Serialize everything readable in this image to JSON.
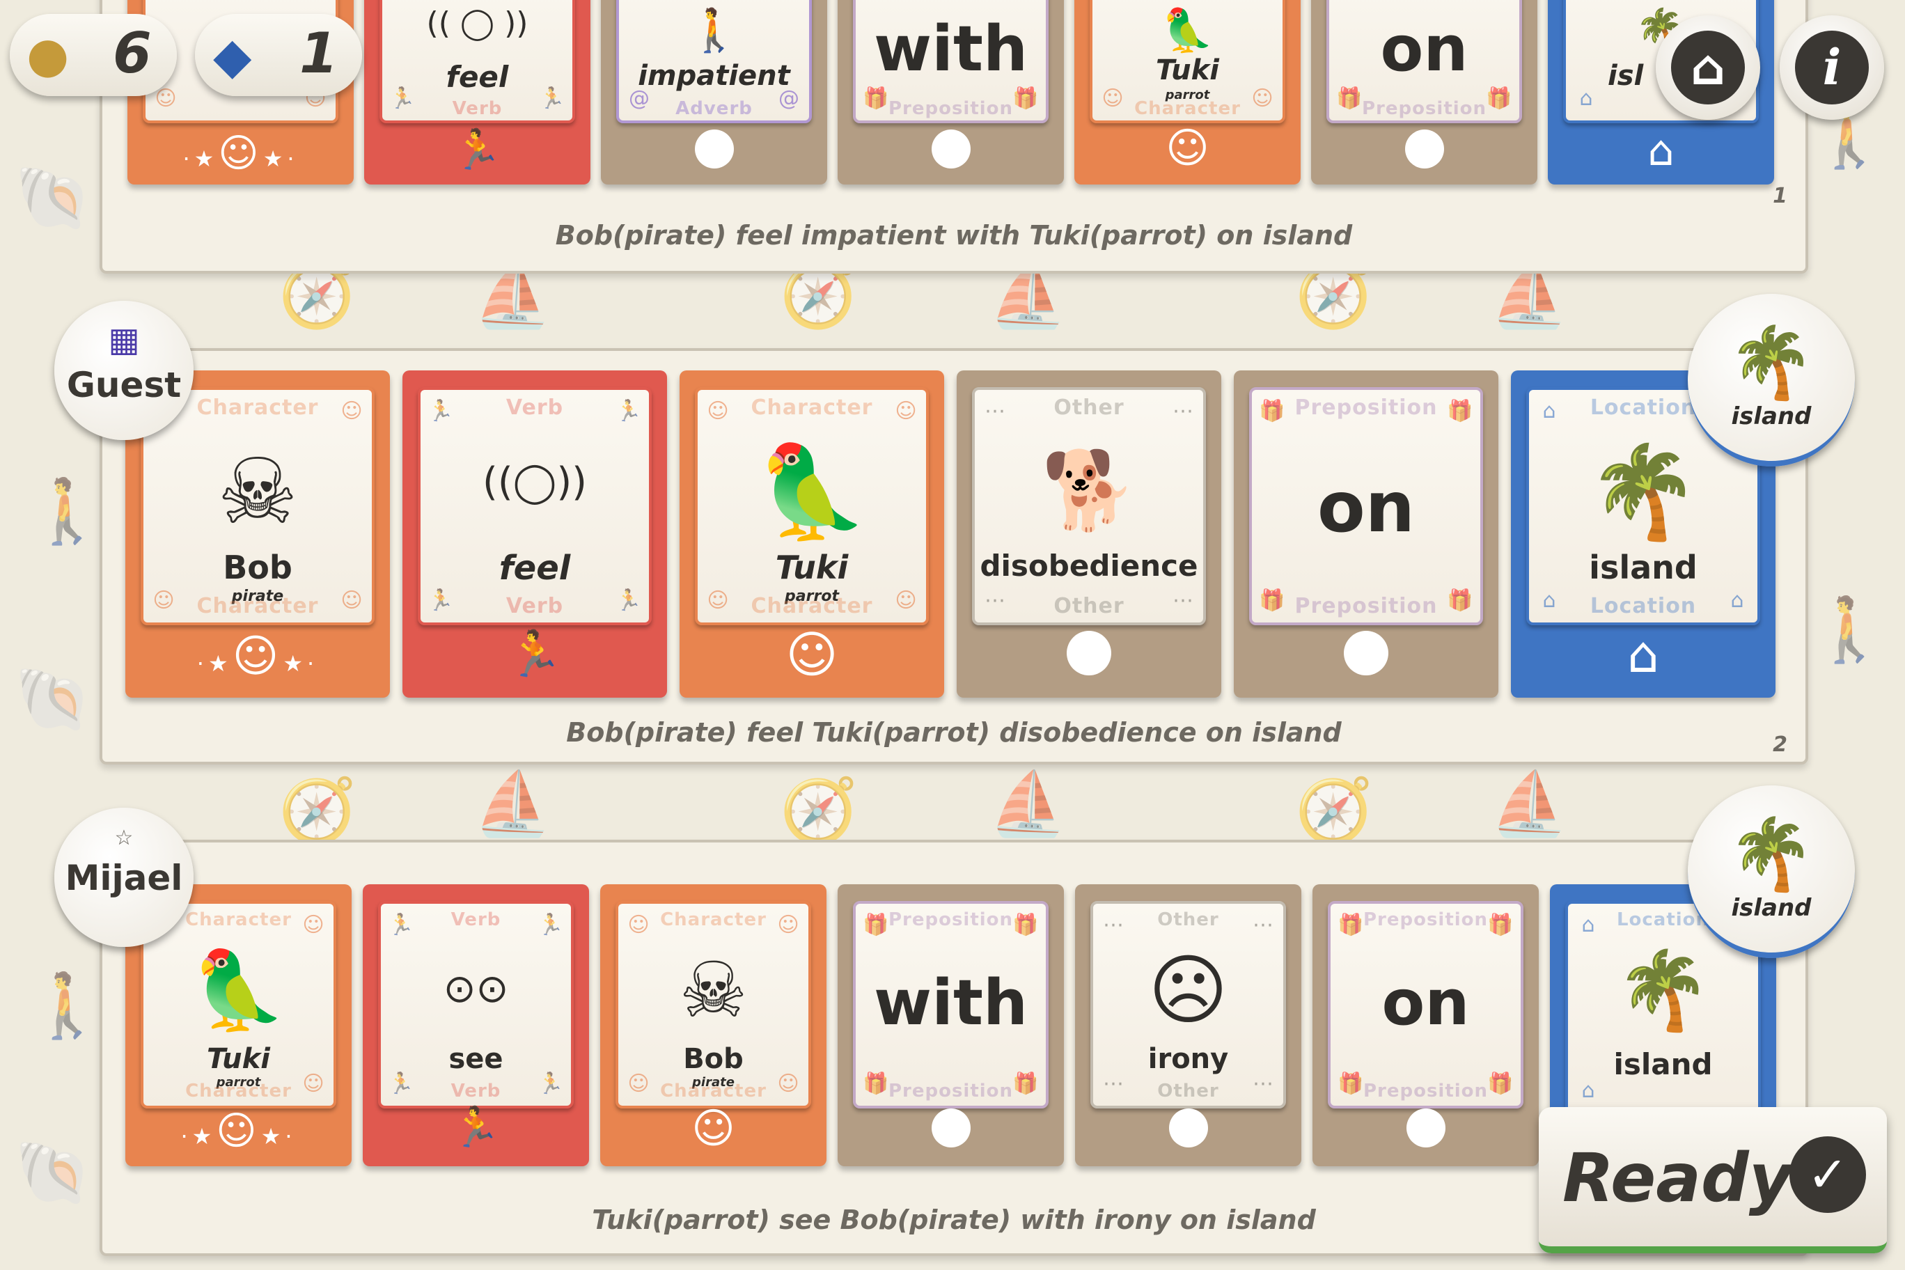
{
  "hud": {
    "coins": "6",
    "gems": "1"
  },
  "colors": {
    "character": "#e8844f",
    "verb": "#e0594f",
    "neutral": "#b39d84",
    "location": "#3f75c3",
    "ready_bar": "#54a347"
  },
  "rows": [
    {
      "caption": "Bob(pirate) feel impatient with Tuki(parrot) on island",
      "number": "1",
      "cards": [
        {
          "type": "character",
          "word": "",
          "sub": "",
          "cat": "Character",
          "icon": "",
          "footer": "stars-smile"
        },
        {
          "type": "verb",
          "word": "feel",
          "cat": "Verb",
          "icon": "(( ◯ ))",
          "footer": "runner"
        },
        {
          "type": "adverb",
          "word": "impatient",
          "cat": "Adverb",
          "icon": "",
          "footer": "dot"
        },
        {
          "type": "preposition",
          "word": "with",
          "cat": "Preposition",
          "footer": "dot"
        },
        {
          "type": "character",
          "word": "Tuki",
          "sub": "parrot",
          "cat": "Character",
          "icon": "",
          "footer": "smile"
        },
        {
          "type": "preposition",
          "word": "on",
          "cat": "Preposition",
          "footer": "dot"
        },
        {
          "type": "location",
          "word": "isl",
          "cat": "Location",
          "icon": "",
          "footer": "house"
        }
      ]
    },
    {
      "player": "Guest",
      "caption": "Bob(pirate) feel Tuki(parrot) disobedience on island",
      "number": "2",
      "location_badge": "island",
      "cards": [
        {
          "type": "character",
          "word": "Bob",
          "sub": "pirate",
          "cat": "Character",
          "icon": "☠",
          "footer": "stars-smile"
        },
        {
          "type": "verb",
          "word": "feel",
          "cat": "Verb",
          "icon": "((◯))",
          "footer": "runner"
        },
        {
          "type": "character",
          "word": "Tuki",
          "sub": "parrot",
          "cat": "Character",
          "icon": "🦜",
          "footer": "smile"
        },
        {
          "type": "other",
          "word": "disobedience",
          "cat": "Other",
          "icon": "🐕",
          "footer": "dot"
        },
        {
          "type": "preposition",
          "word": "on",
          "cat": "Preposition",
          "footer": "dot"
        },
        {
          "type": "location",
          "word": "island",
          "cat": "Location",
          "icon": "🌴",
          "footer": "house"
        }
      ]
    },
    {
      "player": "Mijael",
      "caption": "Tuki(parrot) see Bob(pirate) with irony on island",
      "location_badge": "island",
      "cards": [
        {
          "type": "character",
          "word": "Tuki",
          "sub": "parrot",
          "cat": "Character",
          "icon": "🦜",
          "footer": "stars-smile"
        },
        {
          "type": "verb",
          "word": "see",
          "cat": "Verb",
          "icon": "⊙⊙",
          "footer": "runner"
        },
        {
          "type": "character",
          "word": "Bob",
          "sub": "pirate",
          "cat": "Character",
          "icon": "☠",
          "footer": "smile"
        },
        {
          "type": "preposition",
          "word": "with",
          "cat": "Preposition",
          "footer": "dot"
        },
        {
          "type": "other",
          "word": "irony",
          "cat": "Other",
          "icon": "☹",
          "footer": "dot"
        },
        {
          "type": "preposition",
          "word": "on",
          "cat": "Preposition",
          "footer": "dot"
        },
        {
          "type": "location",
          "word": "island",
          "cat": "Location",
          "icon": "🌴",
          "footer": "house"
        }
      ]
    }
  ],
  "ready_label": "Ready"
}
